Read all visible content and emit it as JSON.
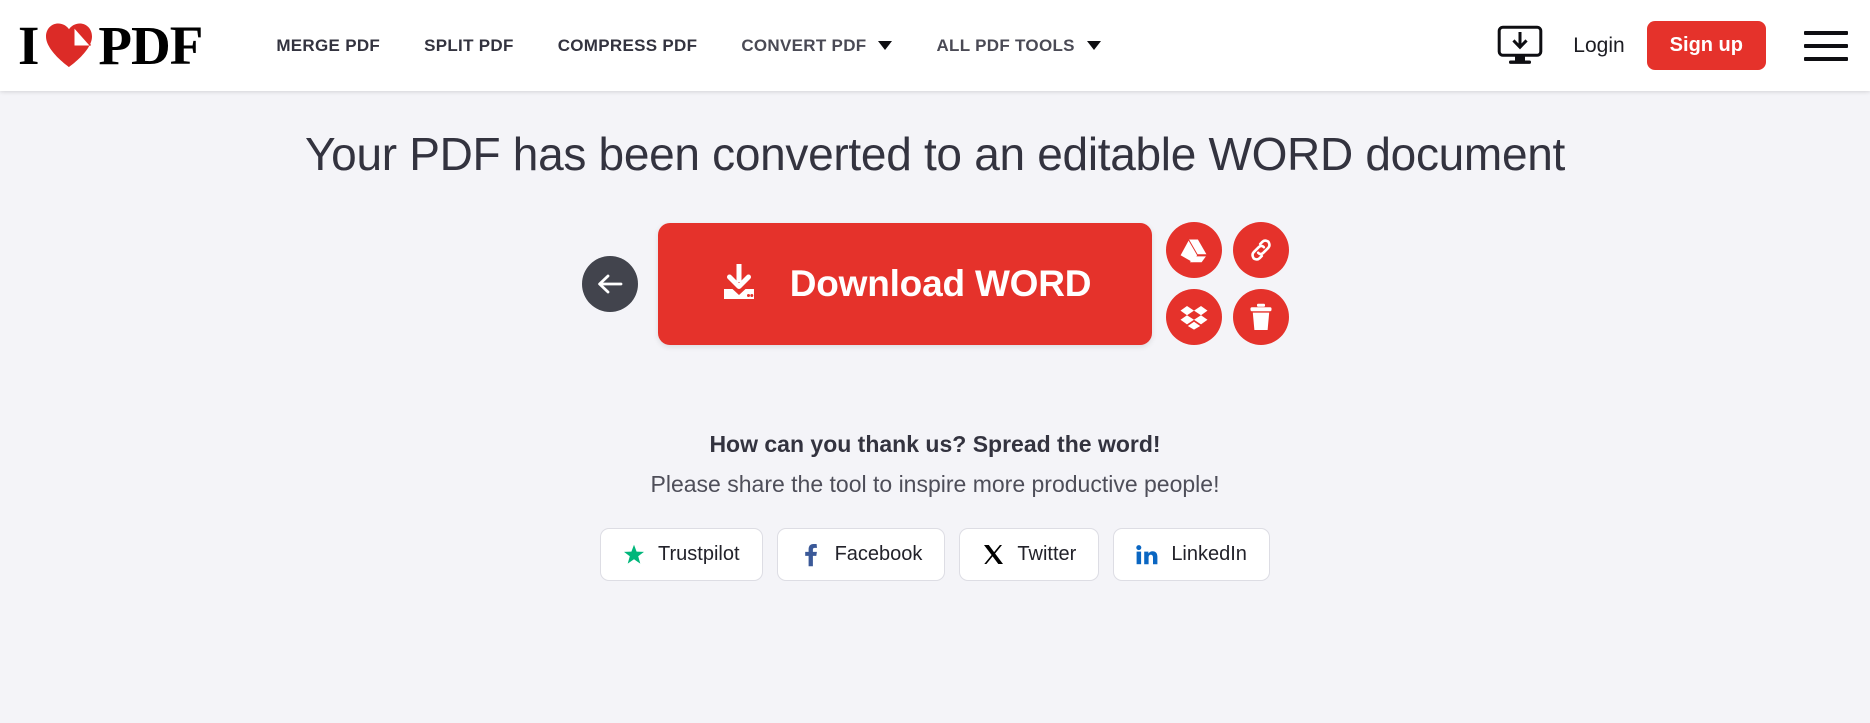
{
  "brand": {
    "logo_text_left": "I",
    "logo_icon": "heart-page-icon",
    "logo_text_right": "PDF",
    "accent_color": "#e5322b",
    "page_background": "#f4f4f8",
    "text_color": "#33333f"
  },
  "header": {
    "nav": [
      {
        "label": "MERGE PDF",
        "has_caret": false,
        "name": "nav-merge-pdf"
      },
      {
        "label": "SPLIT PDF",
        "has_caret": false,
        "name": "nav-split-pdf"
      },
      {
        "label": "COMPRESS PDF",
        "has_caret": false,
        "name": "nav-compress-pdf"
      },
      {
        "label": "CONVERT PDF",
        "has_caret": true,
        "name": "nav-convert-pdf"
      },
      {
        "label": "ALL PDF TOOLS",
        "has_caret": true,
        "name": "nav-all-pdf-tools"
      }
    ],
    "desktop_icon": "monitor-download-icon",
    "login_label": "Login",
    "signup_label": "Sign up",
    "menu_icon": "hamburger-menu-icon"
  },
  "main": {
    "page_title": "Your PDF has been converted to an editable WORD document",
    "back_icon": "arrow-left-icon",
    "download": {
      "icon": "download-icon",
      "label": "Download WORD"
    },
    "side_actions": [
      {
        "name": "save-to-google-drive-button",
        "icon": "google-drive-icon"
      },
      {
        "name": "copy-link-button",
        "icon": "link-icon"
      },
      {
        "name": "save-to-dropbox-button",
        "icon": "dropbox-icon"
      },
      {
        "name": "delete-file-button",
        "icon": "trash-icon"
      }
    ]
  },
  "share": {
    "title": "How can you thank us? Spread the word!",
    "subtitle": "Please share the tool to inspire more productive people!",
    "buttons": [
      {
        "label": "Trustpilot",
        "icon": "trustpilot-star-icon",
        "color": "#00b67a"
      },
      {
        "label": "Facebook",
        "icon": "facebook-icon",
        "color": "#3b5998"
      },
      {
        "label": "Twitter",
        "icon": "twitter-x-icon",
        "color": "#000000"
      },
      {
        "label": "LinkedIn",
        "icon": "linkedin-icon",
        "color": "#0a66c2"
      }
    ]
  }
}
